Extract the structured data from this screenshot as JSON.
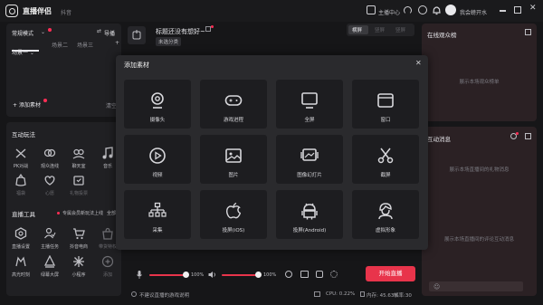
{
  "app": {
    "title": "直播伴侣",
    "subtitle": "抖音"
  },
  "header": {
    "screen_link": "主播中心",
    "user_name": "我会螃开水"
  },
  "scenes": {
    "mode_label": "常规模式",
    "guide_label": "导播",
    "tabs": [
      "场景一",
      "场景二",
      "场景三"
    ],
    "add_material": "添加素材",
    "clear": "清空"
  },
  "stream_info": {
    "title": "标题还没有想好~",
    "category": "未选分类"
  },
  "orientation_tabs": [
    "横屏",
    "竖屏",
    "竖屏"
  ],
  "interactive": {
    "title": "互动玩法",
    "items": [
      {
        "label": "PK对战",
        "icon": "pk-icon"
      },
      {
        "label": "观众连线",
        "icon": "link-icon"
      },
      {
        "label": "聊天室",
        "icon": "chat-icon"
      },
      {
        "label": "音乐",
        "icon": "music-icon"
      },
      {
        "label": "福袋",
        "icon": "bag-icon"
      },
      {
        "label": "心愿",
        "icon": "wish-icon"
      },
      {
        "label": "礼物投票",
        "icon": "vote-icon"
      }
    ]
  },
  "live_tools": {
    "title": "直播工具",
    "notice": "专属会员新玩法上线",
    "all": "全部",
    "items": [
      {
        "label": "直播设置",
        "icon": "settings-icon",
        "dim": false
      },
      {
        "label": "主播任务",
        "icon": "task-icon",
        "dim": false
      },
      {
        "label": "抖音电商",
        "icon": "cart-icon",
        "dim": false
      },
      {
        "label": "带货特权",
        "icon": "shop-icon",
        "dim": true
      },
      {
        "label": "高光时刻",
        "icon": "highlight-icon",
        "dim": false
      },
      {
        "label": "绿幕大屏",
        "icon": "greenscreen-icon",
        "dim": false
      },
      {
        "label": "小程序",
        "icon": "miniapp-icon",
        "dim": false
      },
      {
        "label": "添加",
        "icon": "plus-circle-icon",
        "dim": true
      }
    ]
  },
  "modal": {
    "title": "添加素材",
    "tiles": [
      {
        "label": "摄像头",
        "icon": "camera-icon"
      },
      {
        "label": "游戏进程",
        "icon": "gamepad-icon"
      },
      {
        "label": "全屏",
        "icon": "monitor-icon"
      },
      {
        "label": "窗口",
        "icon": "window-icon"
      },
      {
        "label": "视频",
        "icon": "play-icon"
      },
      {
        "label": "图片",
        "icon": "image-icon"
      },
      {
        "label": "图像幻灯片",
        "icon": "slideshow-icon"
      },
      {
        "label": "截屏",
        "icon": "scissors-icon"
      },
      {
        "label": "采集",
        "icon": "capture-icon"
      },
      {
        "label": "投屏(iOS)",
        "icon": "apple-icon"
      },
      {
        "label": "投屏(Android)",
        "icon": "android-icon"
      },
      {
        "label": "虚拟形象",
        "icon": "avatar-icon"
      }
    ]
  },
  "audio": {
    "mic_percent": "100%",
    "speaker_percent": "100%",
    "mic_level": 1.0,
    "speaker_level": 1.0
  },
  "start_button": "开始直播",
  "status": {
    "warning": "不建议直播的游戏说明",
    "cpu": "CPU: 0.22%",
    "memory": "内存: 45.63%",
    "fps": "帧率:30"
  },
  "right": {
    "audience_title": "在线观众榜",
    "audience_empty": "展示本场观众榜单",
    "messages_title": "互动消息",
    "gift_empty": "展示本场直播间的礼物消息",
    "comment_empty": "展示本场直播间的评论互动消息"
  },
  "colors": {
    "accent": "#e8344b",
    "badge": "#ff2e55",
    "panel": "#202023",
    "modal": "#2a2a2d",
    "tile": "#1d1d20"
  }
}
